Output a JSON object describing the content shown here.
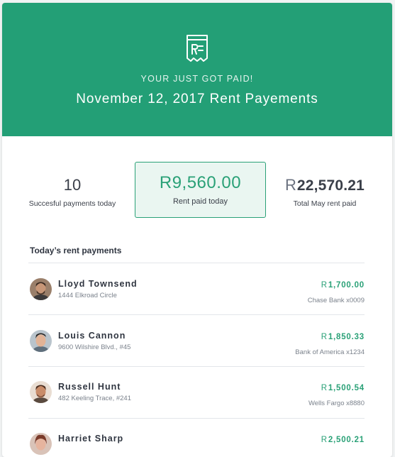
{
  "header": {
    "kicker": "YOUR JUST GOT PAID!",
    "title": "November 12, 2017 Rent Payements",
    "icon": "receipt-icon",
    "color": "#239f76"
  },
  "stats": {
    "successful": {
      "value": "10",
      "label": "Succesful payments today"
    },
    "rent_today": {
      "value": "R9,560.00",
      "label": "Rent paid today"
    },
    "total_may": {
      "currency": "R",
      "value": "22,570.21",
      "label": "Total May rent paid"
    }
  },
  "payments_section": {
    "title": "Today’s rent payments",
    "rows": [
      {
        "name": "Lloyd Townsend",
        "address": "1444 Elkroad Circle",
        "currency": "R",
        "amount": "1,700.00",
        "bank": "Chase Bank x0009"
      },
      {
        "name": "Louis Cannon",
        "address": "9600 Wilshire Blvd., #45",
        "currency": "R",
        "amount": "1,850.33",
        "bank": "Bank of America x1234"
      },
      {
        "name": "Russell Hunt",
        "address": "482 Keeling Trace, #241",
        "currency": "R",
        "amount": "1,500.54",
        "bank": "Wells Fargo x8880"
      },
      {
        "name": "Harriet Sharp",
        "address": "",
        "currency": "R",
        "amount": "2,500.21",
        "bank": ""
      }
    ]
  },
  "colors": {
    "accent": "#2aa177",
    "highlight_bg": "#eaf6f1"
  }
}
